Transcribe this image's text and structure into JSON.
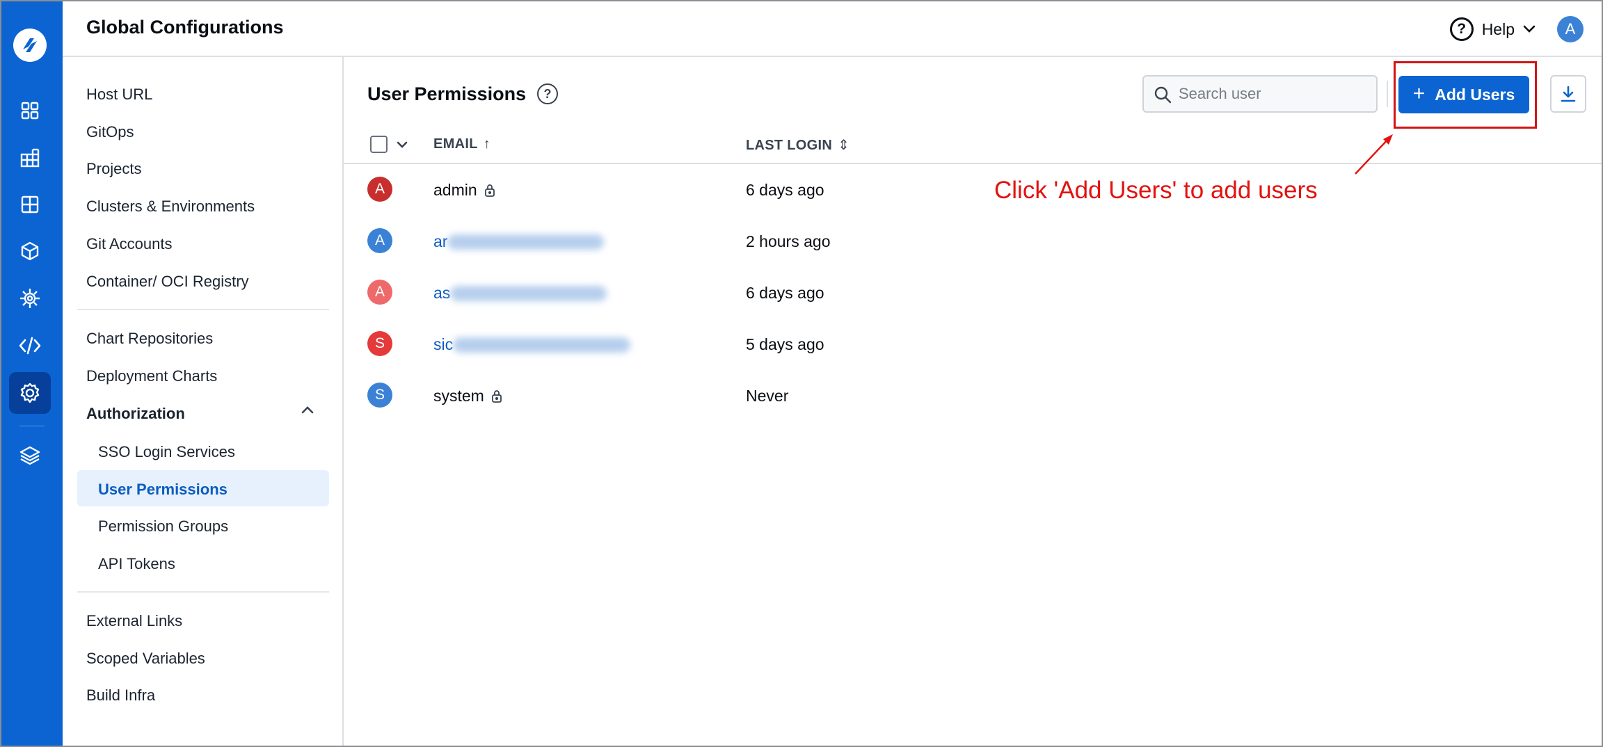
{
  "header": {
    "title": "Global Configurations",
    "help_label": "Help",
    "user_initial": "A"
  },
  "nav": {
    "items": [
      {
        "label": "Host URL"
      },
      {
        "label": "GitOps"
      },
      {
        "label": "Projects"
      },
      {
        "label": "Clusters & Environments"
      },
      {
        "label": "Git Accounts"
      },
      {
        "label": "Container/ OCI Registry"
      },
      {
        "label": "Chart Repositories"
      },
      {
        "label": "Deployment Charts"
      },
      {
        "label": "Authorization"
      },
      {
        "label": "SSO Login Services"
      },
      {
        "label": "User Permissions"
      },
      {
        "label": "Permission Groups"
      },
      {
        "label": "API Tokens"
      },
      {
        "label": "External Links"
      },
      {
        "label": "Scoped Variables"
      },
      {
        "label": "Build Infra"
      }
    ],
    "active": "User Permissions"
  },
  "main": {
    "title": "User Permissions",
    "search_placeholder": "Search user",
    "add_users_label": "Add Users",
    "columns": {
      "email": "EMAIL",
      "email_sort_icon": "↑",
      "last_login": "LAST LOGIN",
      "last_login_sort_icon": "⇕"
    },
    "rows": [
      {
        "initial": "A",
        "avatar_color": "#c82e2e",
        "email": "admin",
        "locked": true,
        "last_login": "6 days ago"
      },
      {
        "initial": "A",
        "avatar_color": "#3b82d6",
        "email": "ar",
        "locked": false,
        "last_login": "2 hours ago"
      },
      {
        "initial": "A",
        "avatar_color": "#ee6a6a",
        "email": "as",
        "locked": false,
        "last_login": "6 days ago"
      },
      {
        "initial": "S",
        "avatar_color": "#e53a3a",
        "email": "sic",
        "locked": false,
        "last_login": "5 days ago"
      },
      {
        "initial": "S",
        "avatar_color": "#3b82d6",
        "email": "system",
        "locked": true,
        "last_login": "Never"
      }
    ]
  },
  "annotation": {
    "text": "Click 'Add Users' to add users",
    "color": "#e3120f"
  },
  "colors": {
    "brand_blue": "#0b64d2",
    "rail_active": "#06409a",
    "nav_active_bg": "#e6f1fd",
    "link_blue": "#0b5cc0"
  }
}
